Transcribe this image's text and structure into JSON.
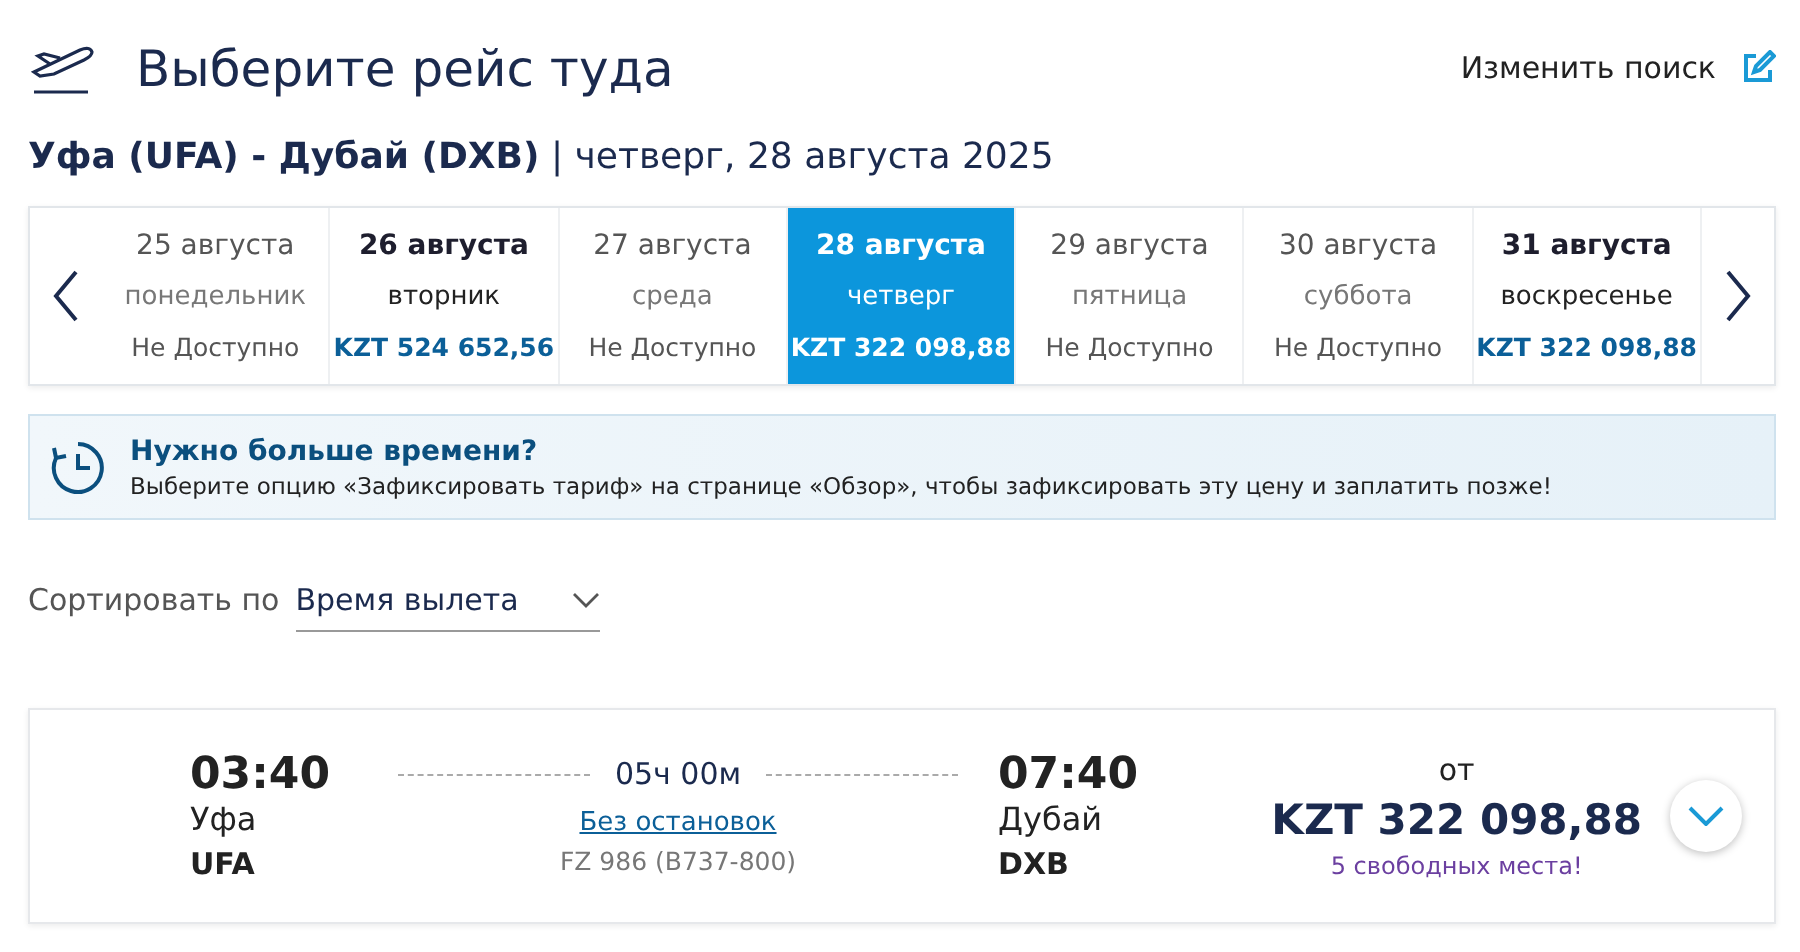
{
  "header": {
    "title": "Выберите рейс туда",
    "modify_link": "Изменить поиск"
  },
  "route": "**Уфа (UFA) - Дубай (DXB)** | четверг, 28 августа 2025",
  "dates": [
    {
      "date": "25 августа",
      "weekday": "понедельник",
      "price": "Не Доступно",
      "available": false,
      "selected": false
    },
    {
      "date": "26 августа",
      "weekday": "вторник",
      "price": "KZT 524 652,56",
      "available": true,
      "selected": false
    },
    {
      "date": "27 августа",
      "weekday": "среда",
      "price": "Не Доступно",
      "available": false,
      "selected": false
    },
    {
      "date": "28 августа",
      "weekday": "четверг",
      "price": "KZT 322 098,88",
      "available": true,
      "selected": true
    },
    {
      "date": "29 августа",
      "weekday": "пятница",
      "price": "Не Доступно",
      "available": false,
      "selected": false
    },
    {
      "date": "30 августа",
      "weekday": "суббота",
      "price": "Не Доступно",
      "available": false,
      "selected": false
    },
    {
      "date": "31 августа",
      "weekday": "воскресенье",
      "price": "KZT 322 098,88",
      "available": true,
      "selected": false
    }
  ],
  "notice": {
    "title": "Нужно больше времени?",
    "text": "Выберите опцию «Зафиксировать тариф» на странице «Обзор», чтобы зафиксировать эту цену и заплатить позже!"
  },
  "sort": {
    "label": "Сортировать по",
    "value": "Время вылета"
  },
  "flight": {
    "depart_time": "03:40",
    "depart_city": "Уфа",
    "depart_code": "UFA",
    "duration": "05ч 00м",
    "stops": "Без остановок",
    "flight_no": "FZ 986 (B737-800)",
    "arrive_time": "07:40",
    "arrive_city": "Дубай",
    "arrive_code": "DXB",
    "from": "от",
    "price": "KZT 322 098,88",
    "seats": "5 свободных места!"
  }
}
